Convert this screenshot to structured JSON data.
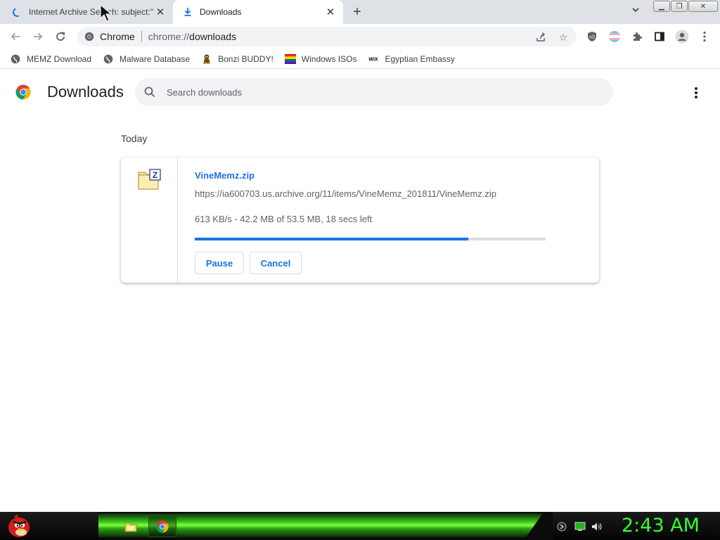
{
  "tabs": [
    {
      "title": "Internet Archive Search: subject:\"",
      "state": "loading"
    },
    {
      "title": "Downloads",
      "state": "active"
    }
  ],
  "omnibox": {
    "site_label": "Chrome",
    "url_scheme": "chrome://",
    "url_host": "downloads"
  },
  "bookmarks": [
    {
      "label": "MEMZ Download",
      "icon": "globe-icon"
    },
    {
      "label": "Malware Database",
      "icon": "globe-icon"
    },
    {
      "label": "Bonzi BUDDY!",
      "icon": "bonzi-icon"
    },
    {
      "label": "Windows ISOs",
      "icon": "rainbow-flag-icon"
    },
    {
      "label": "Egyptian Embassy",
      "icon": "wix-icon"
    }
  ],
  "page": {
    "title": "Downloads",
    "search_placeholder": "Search downloads",
    "section_date": "Today"
  },
  "download": {
    "file_name": "VineMemz.zip",
    "url": "https://ia600703.us.archive.org/11/items/VineMemz_201811/VineMemz.zip",
    "status": "613 KB/s - 42.2 MB of 53.5 MB, 18 secs left",
    "progress": 0.78,
    "pause_label": "Pause",
    "cancel_label": "Cancel"
  },
  "taskbar": {
    "clock": "2:43 AM"
  },
  "colors": {
    "accent": "#1a73e8",
    "clock": "#33ff33",
    "taskbar_glow": "#39c21a"
  }
}
